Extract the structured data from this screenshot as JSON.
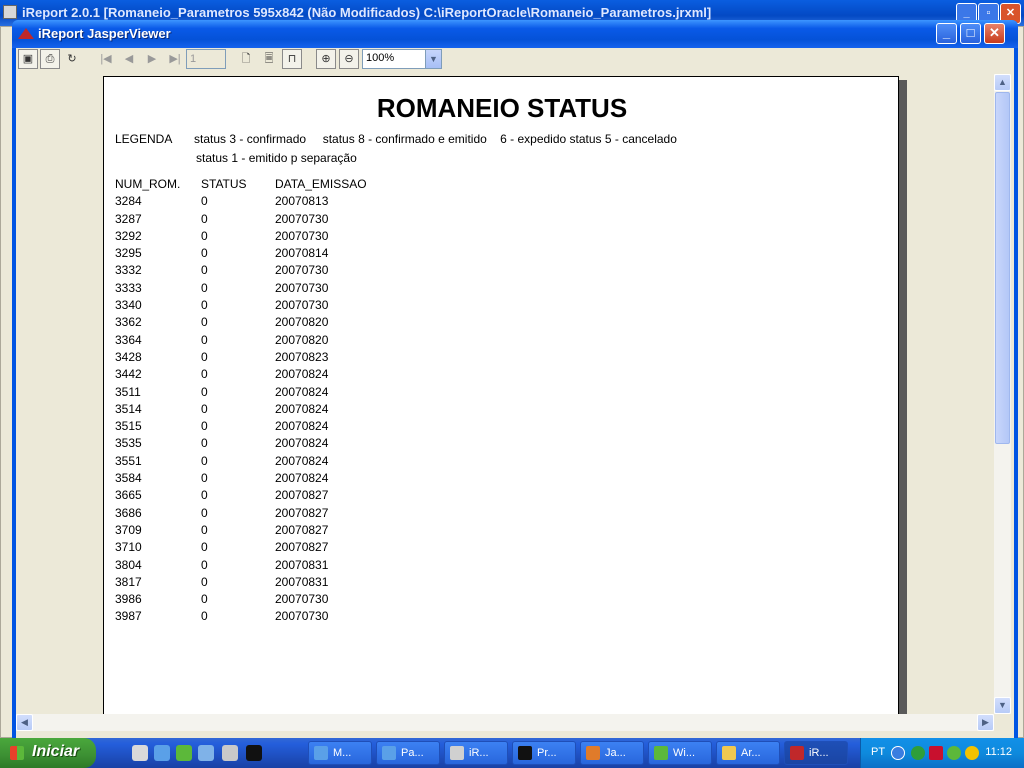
{
  "background_window": {
    "title": "iReport 2.0.1  [Romaneio_Parametros 595x842 (Não Modificados) C:\\iReportOracle\\Romaneio_Parametros.jrxml]"
  },
  "viewer": {
    "title": "iReport JasperViewer",
    "buttons": {
      "minimize": "_",
      "maximize": "□",
      "close": "✕"
    }
  },
  "toolbar": {
    "page_number": "1",
    "zoom": "100%",
    "icons": [
      "save-icon",
      "print-icon",
      "reload-icon",
      "first-page-icon",
      "previous-page-icon",
      "next-page-icon",
      "last-page-icon",
      "actual-size-icon",
      "fit-page-icon",
      "fit-width-icon",
      "zoom-in-icon",
      "zoom-out-icon"
    ]
  },
  "report": {
    "title": "ROMANEIO STATUS",
    "legend_label": "LEGENDA",
    "legend_line1": "status 3 - confirmado     status 8 - confirmado e emitido    6 - expedido status 5 - cancelado",
    "legend_line2": "status 1 - emitido p separação",
    "columns": [
      "NUM_ROM.",
      "STATUS",
      "DATA_EMISSAO"
    ],
    "rows": [
      [
        "3284",
        "0",
        "20070813"
      ],
      [
        "3287",
        "0",
        "20070730"
      ],
      [
        "3292",
        "0",
        "20070730"
      ],
      [
        "3295",
        "0",
        "20070814"
      ],
      [
        "3332",
        "0",
        "20070730"
      ],
      [
        "3333",
        "0",
        "20070730"
      ],
      [
        "3340",
        "0",
        "20070730"
      ],
      [
        "3362",
        "0",
        "20070820"
      ],
      [
        "3364",
        "0",
        "20070820"
      ],
      [
        "3428",
        "0",
        "20070823"
      ],
      [
        "3442",
        "0",
        "20070824"
      ],
      [
        "3511",
        "0",
        "20070824"
      ],
      [
        "3514",
        "0",
        "20070824"
      ],
      [
        "3515",
        "0",
        "20070824"
      ],
      [
        "3535",
        "0",
        "20070824"
      ],
      [
        "3551",
        "0",
        "20070824"
      ],
      [
        "3584",
        "0",
        "20070824"
      ],
      [
        "3665",
        "0",
        "20070827"
      ],
      [
        "3686",
        "0",
        "20070827"
      ],
      [
        "3709",
        "0",
        "20070827"
      ],
      [
        "3710",
        "0",
        "20070827"
      ],
      [
        "3804",
        "0",
        "20070831"
      ],
      [
        "3817",
        "0",
        "20070831"
      ],
      [
        "3986",
        "0",
        "20070730"
      ],
      [
        "3987",
        "0",
        "20070730"
      ]
    ]
  },
  "taskbar": {
    "start_label": "Iniciar",
    "tasks": [
      {
        "label": "M...",
        "icon": "ie-icon",
        "active": false
      },
      {
        "label": "Pa...",
        "icon": "ie-icon",
        "active": false
      },
      {
        "label": "iR...",
        "icon": "ireport-icon",
        "active": false
      },
      {
        "label": "Pr...",
        "icon": "console-icon",
        "active": false
      },
      {
        "label": "Ja...",
        "icon": "java-icon",
        "active": false
      },
      {
        "label": "Wi...",
        "icon": "messenger-icon",
        "active": false
      },
      {
        "label": "Ar...",
        "icon": "folder-icon",
        "active": false
      },
      {
        "label": "iR...",
        "icon": "jasper-icon",
        "active": true
      }
    ],
    "language": "PT",
    "clock": "11:12"
  },
  "colors": {
    "xp_blue": "#0054e3",
    "start_green": "#3c8f33",
    "tray_blue": "#0e8add"
  }
}
